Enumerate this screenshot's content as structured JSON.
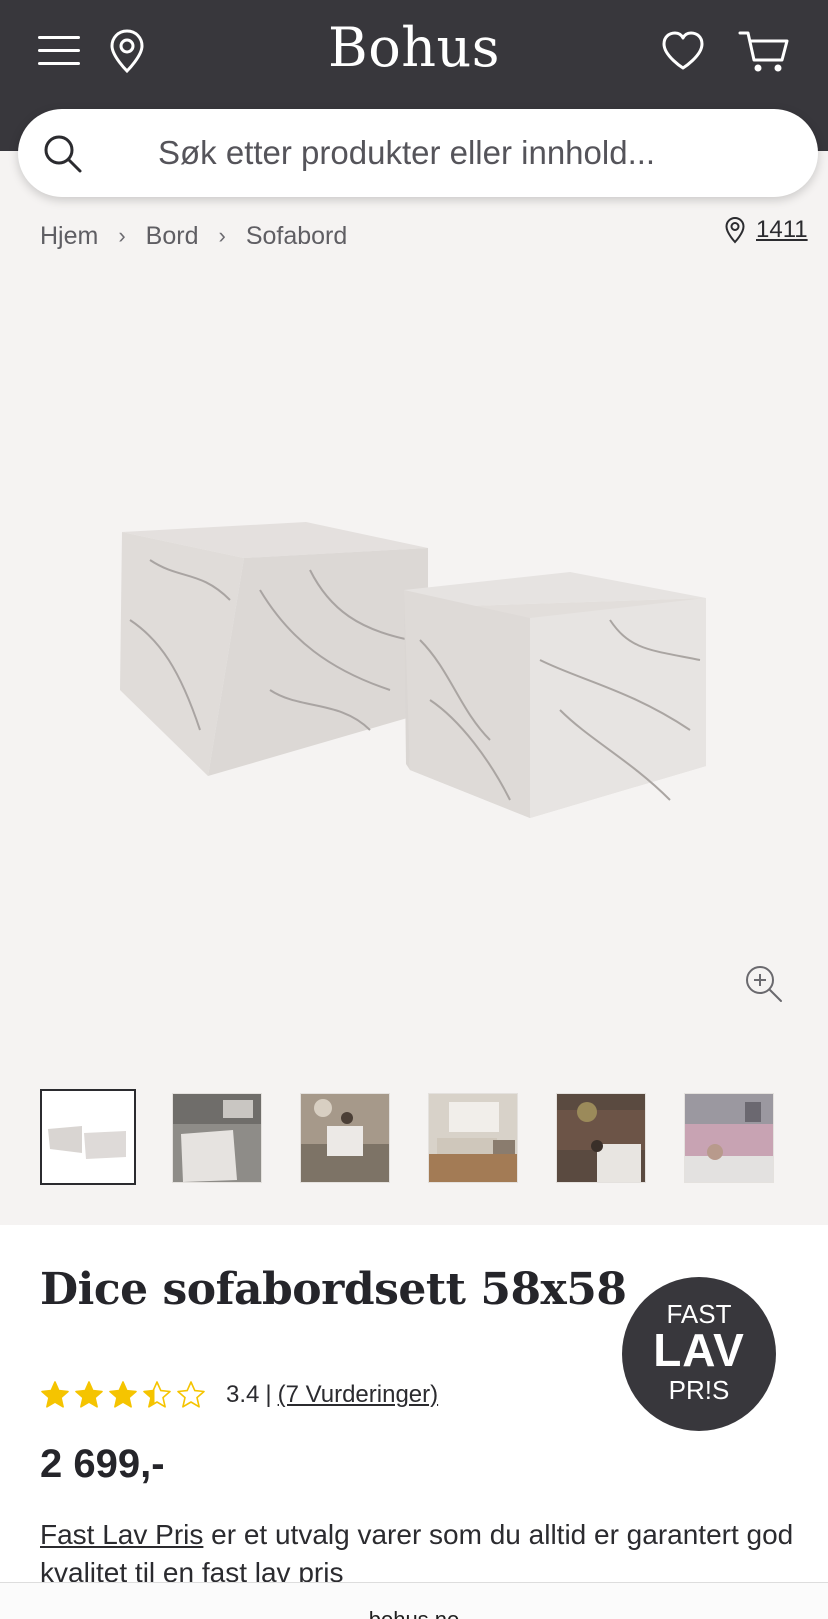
{
  "header": {
    "logo": "Bohus",
    "icons": [
      "menu-icon",
      "location-pin-icon",
      "heart-icon",
      "cart-icon"
    ]
  },
  "search": {
    "placeholder": "Søk etter produkter eller innhold..."
  },
  "breadcrumb": {
    "items": [
      "Hjem",
      "Bord",
      "Sofabord"
    ],
    "separator": "›",
    "store_label": "1411"
  },
  "gallery": {
    "thumbnail_count": 6,
    "active_index": 0
  },
  "product": {
    "title": "Dice sofabordsett 58x58",
    "badge": {
      "line1": "FAST",
      "line2": "LAV",
      "line3": "PR!S"
    },
    "rating": {
      "value": 3.4,
      "value_text": "3.4",
      "divider": "|",
      "reviews_text": "(7 Vurderinger)"
    },
    "price": "2 699,-",
    "description_link": "Fast Lav Pris",
    "description_rest": " er et utvalg varer som du alltid er garantert god kvalitet til en fast lav pris"
  },
  "footer": {
    "domain": "bohus.no"
  },
  "colors": {
    "header_bg": "#38373c",
    "gallery_bg": "#f5f3f2",
    "star": "#f5c400",
    "text": "#2b2b2f"
  }
}
